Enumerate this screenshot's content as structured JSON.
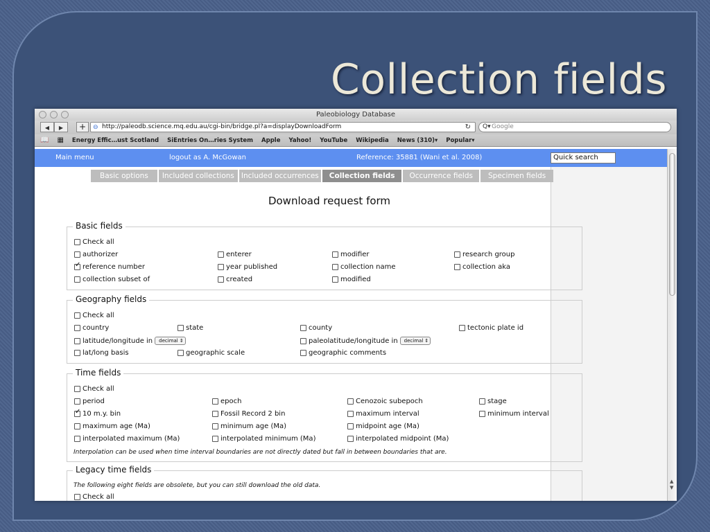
{
  "slide": {
    "title": "Collection fields"
  },
  "browser": {
    "window_title": "Paleobiology Database",
    "url": "http://paleodb.science.mq.edu.au/cgi-bin/bridge.pl?a=displayDownloadForm",
    "search_placeholder": "Google",
    "bookmarks": [
      "Energy Effic…ust Scotland",
      "SiEntries On…ries System",
      "Apple",
      "Yahoo!",
      "YouTube",
      "Wikipedia",
      "News (310)▾",
      "Popular▾"
    ]
  },
  "menu": {
    "main": "Main menu",
    "logout": "logout as A. McGowan",
    "reference": "Reference: 35881 (Wani et al. 2008)",
    "quick_search": "Quick search"
  },
  "tabs": [
    "Basic options",
    "Included collections",
    "Included occurrences",
    "Collection fields",
    "Occurrence fields",
    "Specimen fields"
  ],
  "form": {
    "title": "Download request form",
    "basic": {
      "legend": "Basic fields",
      "check_all": "Check all",
      "fields": [
        "authorizer",
        "enterer",
        "modifier",
        "research group",
        "reference number",
        "year published",
        "collection name",
        "collection aka",
        "collection subset of",
        "created",
        "modified"
      ]
    },
    "geography": {
      "legend": "Geography fields",
      "check_all": "Check all",
      "fields": [
        "country",
        "state",
        "county",
        "tectonic plate id",
        "latitude/longitude in",
        "paleolatitude/longitude in",
        "lat/long basis",
        "geographic scale",
        "geographic comments"
      ],
      "coord_format": "decimal"
    },
    "time": {
      "legend": "Time fields",
      "check_all": "Check all",
      "fields": [
        "period",
        "epoch",
        "Cenozoic subepoch",
        "stage",
        "10 m.y. bin",
        "Fossil Record 2 bin",
        "maximum interval",
        "minimum interval",
        "maximum age (Ma)",
        "minimum age (Ma)",
        "midpoint age (Ma)",
        "interpolated maximum (Ma)",
        "interpolated minimum (Ma)",
        "interpolated midpoint (Ma)"
      ],
      "note": "Interpolation can be used when time interval boundaries are not directly dated but fall in between boundaries that are."
    },
    "legacy": {
      "legend": "Legacy time fields",
      "note": "The following eight fields are obsolete, but you can still download the old data.",
      "check_all": "Check all"
    }
  }
}
